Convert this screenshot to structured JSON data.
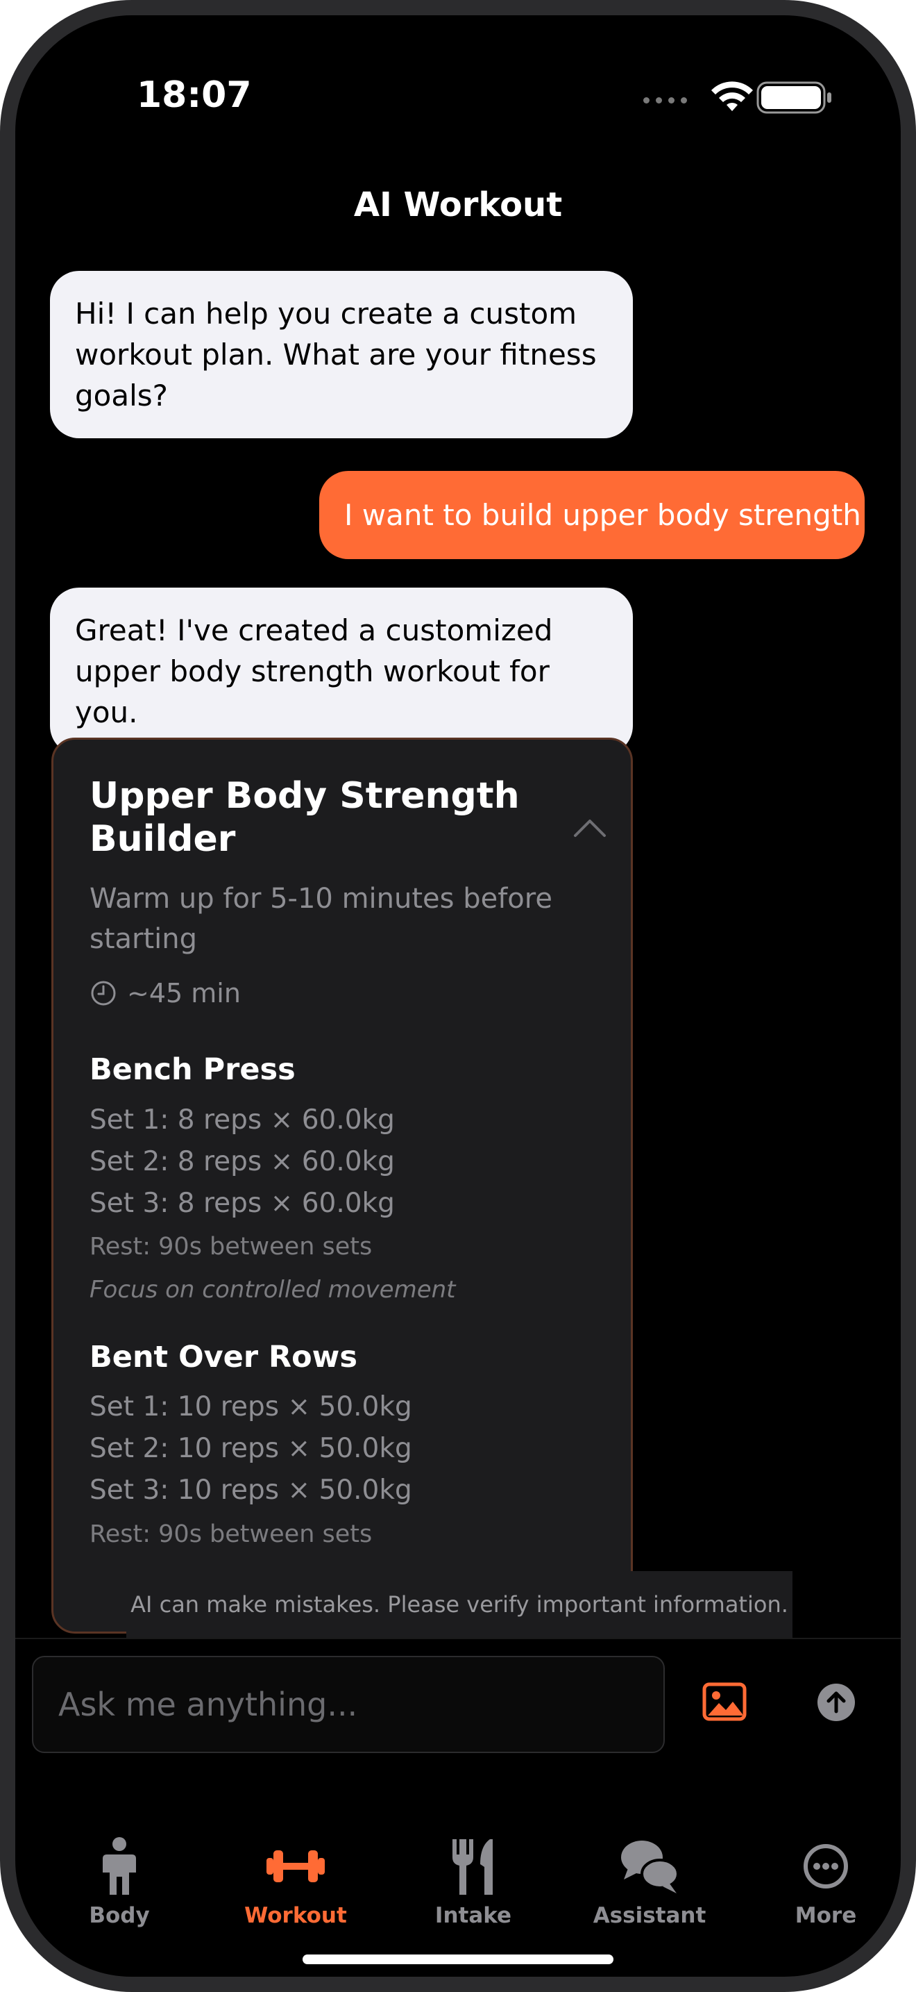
{
  "status_bar": {
    "time": "18:07"
  },
  "header": {
    "title": "AI Workout"
  },
  "messages": [
    {
      "role": "assistant",
      "text": "Hi! I can help you create a custom workout plan. What are your fitness goals?"
    },
    {
      "role": "user",
      "text": "I want to build upper body strength"
    },
    {
      "role": "assistant",
      "text": "Great! I've created a customized upper body strength workout for you."
    }
  ],
  "workout_card": {
    "title": "Upper Body Strength Builder",
    "subtitle": "Warm up for 5-10 minutes before starting",
    "duration": "~45 min",
    "exercises": [
      {
        "name": "Bench Press",
        "sets": [
          "Set 1: 8 reps × 60.0kg",
          "Set 2: 8 reps × 60.0kg",
          "Set 3: 8 reps × 60.0kg"
        ],
        "rest": "Rest: 90s between sets",
        "note": "Focus on controlled movement"
      },
      {
        "name": "Bent Over Rows",
        "sets": [
          "Set 1: 10 reps × 50.0kg",
          "Set 2: 10 reps × 50.0kg",
          "Set 3: 10 reps × 50.0kg"
        ],
        "rest": "Rest: 90s between sets"
      }
    ]
  },
  "disclaimer": "AI can make mistakes. Please verify important information.",
  "composer": {
    "placeholder": "Ask me anything...",
    "value": ""
  },
  "tabs": [
    {
      "label": "Body",
      "icon": "person-icon",
      "active": false
    },
    {
      "label": "Workout",
      "icon": "dumbbell-icon",
      "active": true
    },
    {
      "label": "Intake",
      "icon": "fork-knife-icon",
      "active": false
    },
    {
      "label": "Assistant",
      "icon": "chat-bubbles-icon",
      "active": false
    },
    {
      "label": "More",
      "icon": "ellipsis-circle-icon",
      "active": false
    }
  ],
  "colors": {
    "accent": "#ff6b35",
    "background": "#000000",
    "card": "#1c1c1e",
    "ai_bubble": "#f2f2f7"
  }
}
